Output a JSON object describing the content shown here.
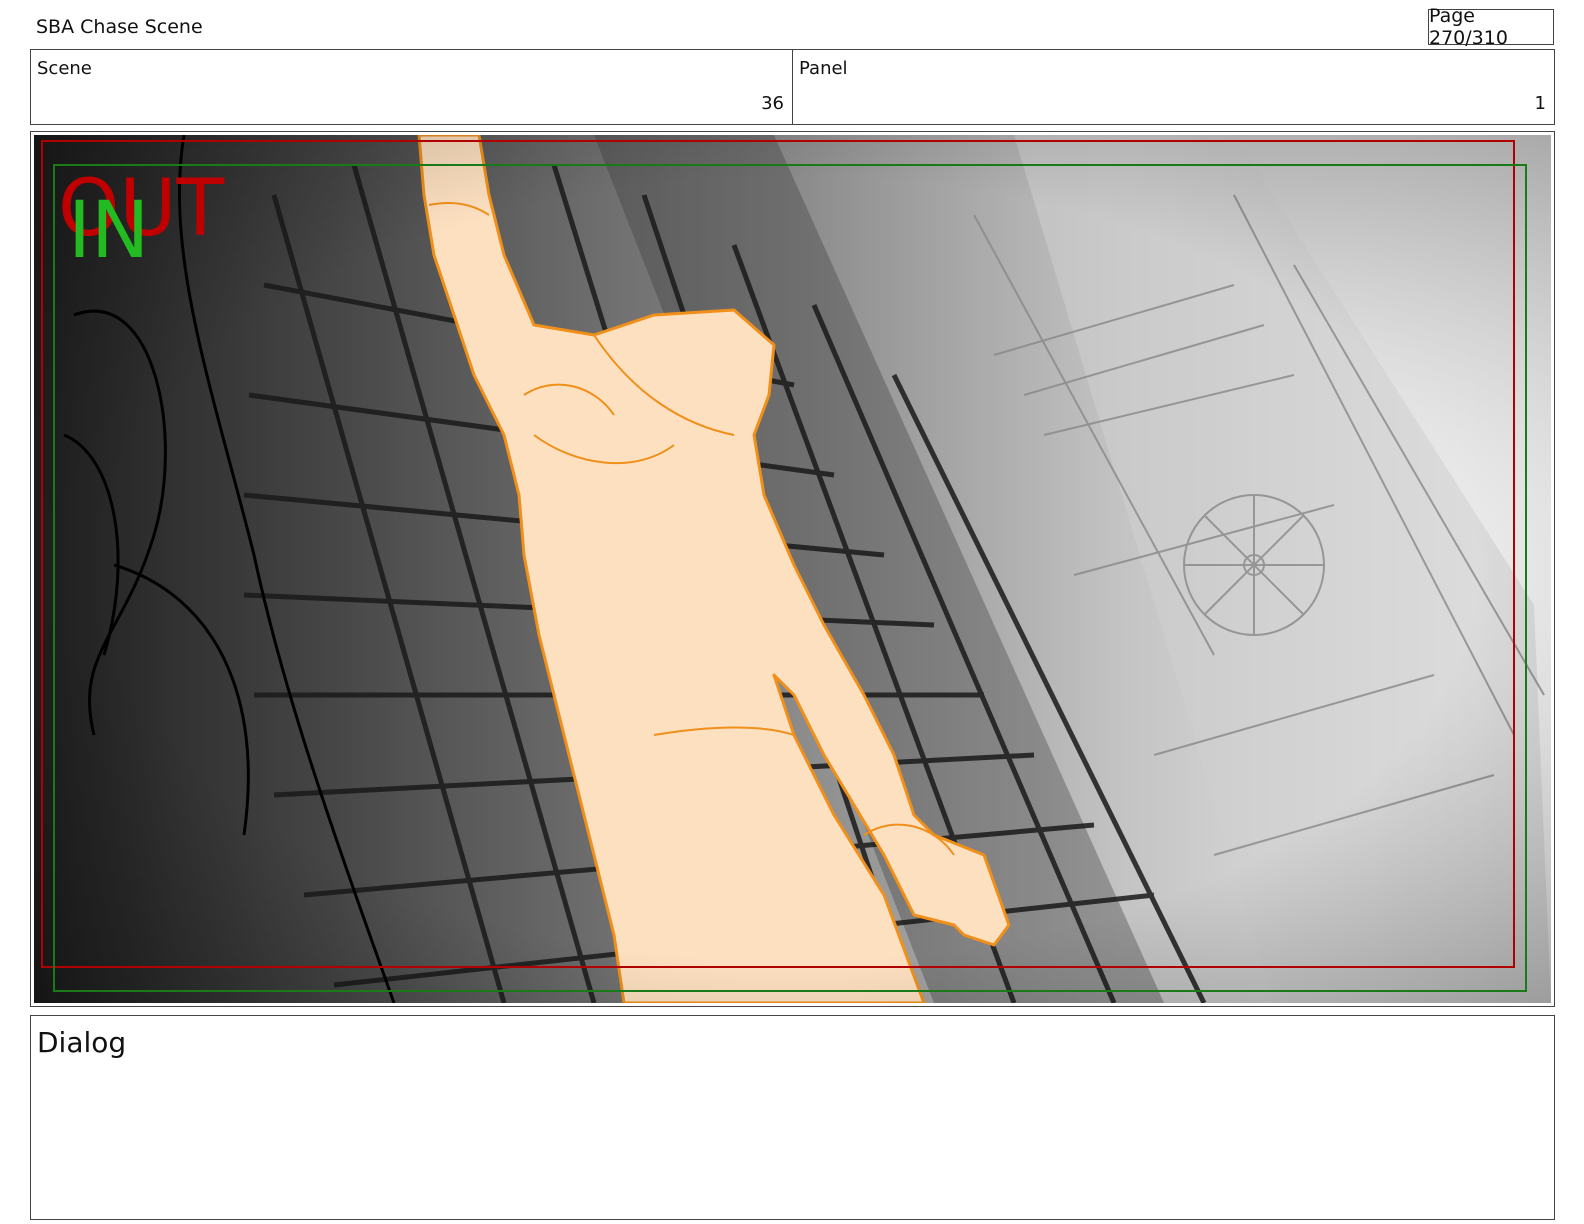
{
  "document": {
    "title": "SBA Chase Scene",
    "page_label": "Page 270/310"
  },
  "info": {
    "scene_label": "Scene",
    "scene_value": "36",
    "panel_label": "Panel",
    "panel_value": "1"
  },
  "panel_image": {
    "out_marker": "OUT",
    "in_marker": "IN",
    "out_frame_color": "#b00000",
    "in_frame_color": "#1a7a1a",
    "character_fill": "#fde0c0",
    "character_stroke": "#f0901a"
  },
  "dialog": {
    "label": "Dialog"
  }
}
